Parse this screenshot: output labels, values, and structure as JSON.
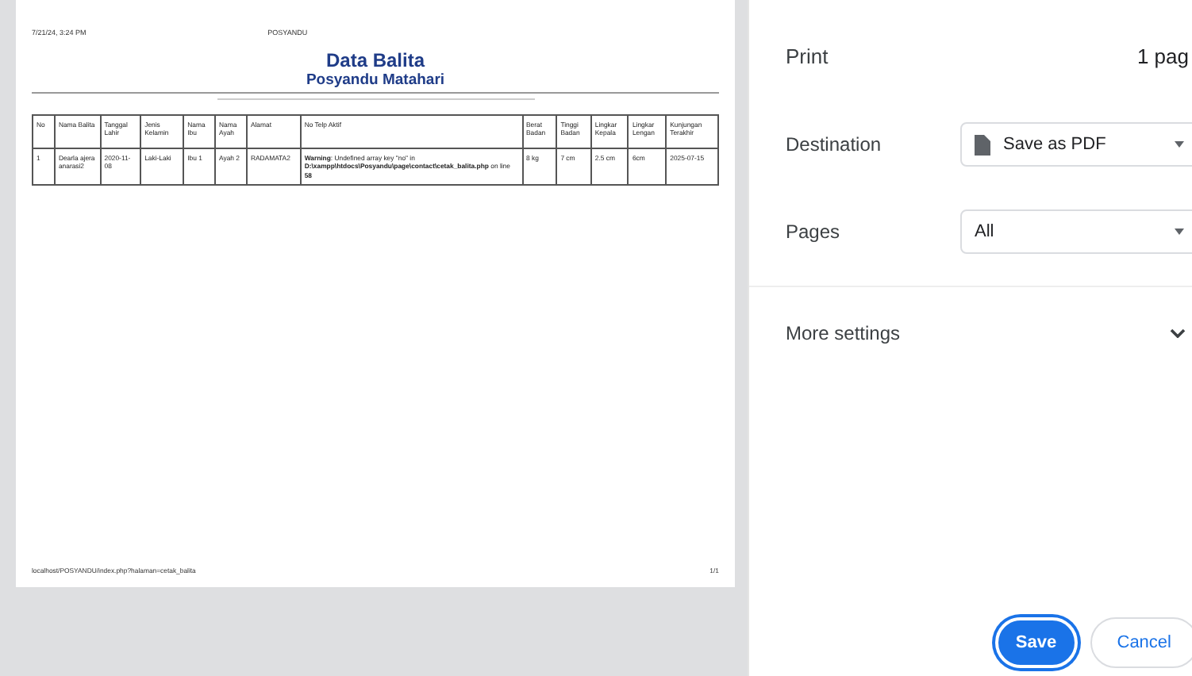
{
  "preview": {
    "header_left": "7/21/24, 3:24 PM",
    "header_center": "POSYANDU",
    "title": "Data Balita",
    "subtitle": "Posyandu Matahari",
    "table": {
      "columns": [
        "No",
        "Nama Balita",
        "Tanggal Lahir",
        "Jenis Kelamin",
        "Nama Ibu",
        "Nama Ayah",
        "Alamat",
        "No Telp Aktif",
        "Berat Badan",
        "Tinggi Badan",
        "Lingkar Kepala",
        "Lingkar Lengan",
        "Kunjungan Terakhir"
      ],
      "rows": [
        [
          "1",
          "Dearla ajera anarasi2",
          "2020-11-08",
          "Laki-Laki",
          "Ibu 1",
          "Ayah 2",
          "RADAMATA2",
          "**Warning**: Undefined array key \"no\" in **D:\\xampp\\htdocs\\Posyandu\\page\\contact\\cetak_balita.php** on line **58**",
          "8 kg",
          "7 cm",
          "2.5 cm",
          "6cm",
          "2025-07-15"
        ]
      ]
    },
    "footer_left": "localhost/POSYANDU/index.php?halaman=cetak_balita",
    "footer_right": "1/1"
  },
  "panel": {
    "title": "Print",
    "page_count": "1 pag",
    "settings": [
      {
        "label": "Destination",
        "value": "Save as PDF",
        "kind": "pdf"
      },
      {
        "label": "Pages",
        "value": "All",
        "kind": "plain"
      }
    ],
    "more_settings": "More settings",
    "buttons": [
      {
        "label": "Save",
        "kind": "primary"
      },
      {
        "label": "Cancel",
        "kind": "secondary"
      }
    ]
  }
}
